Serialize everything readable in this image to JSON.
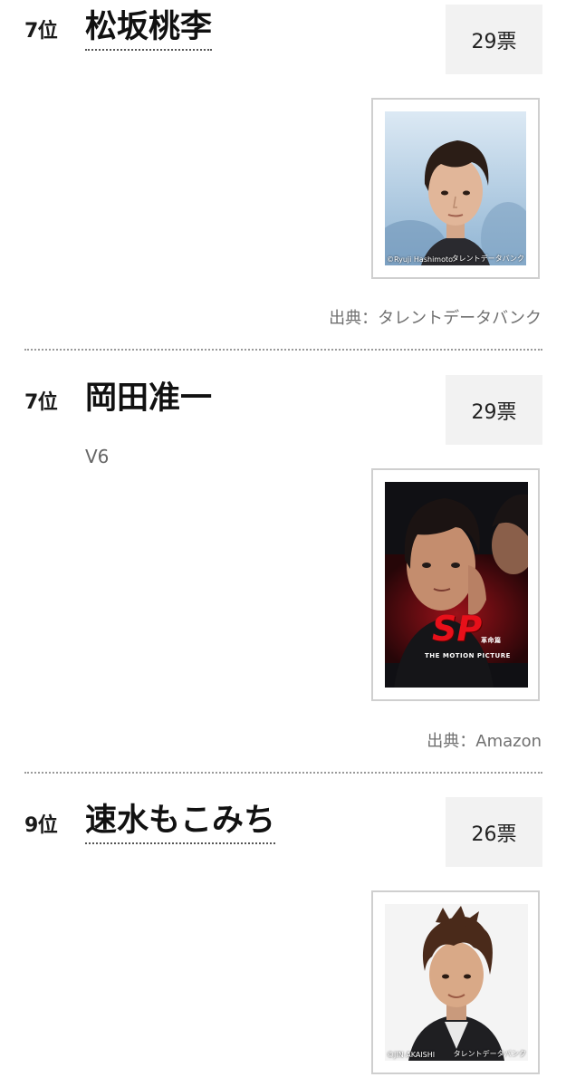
{
  "entries": [
    {
      "rank": "7位",
      "name": "松坂桃李",
      "votes": "29票",
      "photo_credit_left": "©Ryuji Hashimoto",
      "photo_credit_right": "タレントデータバンク",
      "source": "出典：タレントデータバンク"
    },
    {
      "rank": "7位",
      "name": "岡田准一",
      "group": "V6",
      "votes": "29票",
      "poster_logo": "SP",
      "poster_logo_sub": "革命篇",
      "poster_subtitle": "THE MOTION PICTURE",
      "source": "出典：Amazon"
    },
    {
      "rank": "9位",
      "name": "速水もこみち",
      "votes": "26票",
      "photo_credit_left": "©JIN AKAISHI",
      "photo_credit_right": "タレントデータバンク"
    }
  ]
}
